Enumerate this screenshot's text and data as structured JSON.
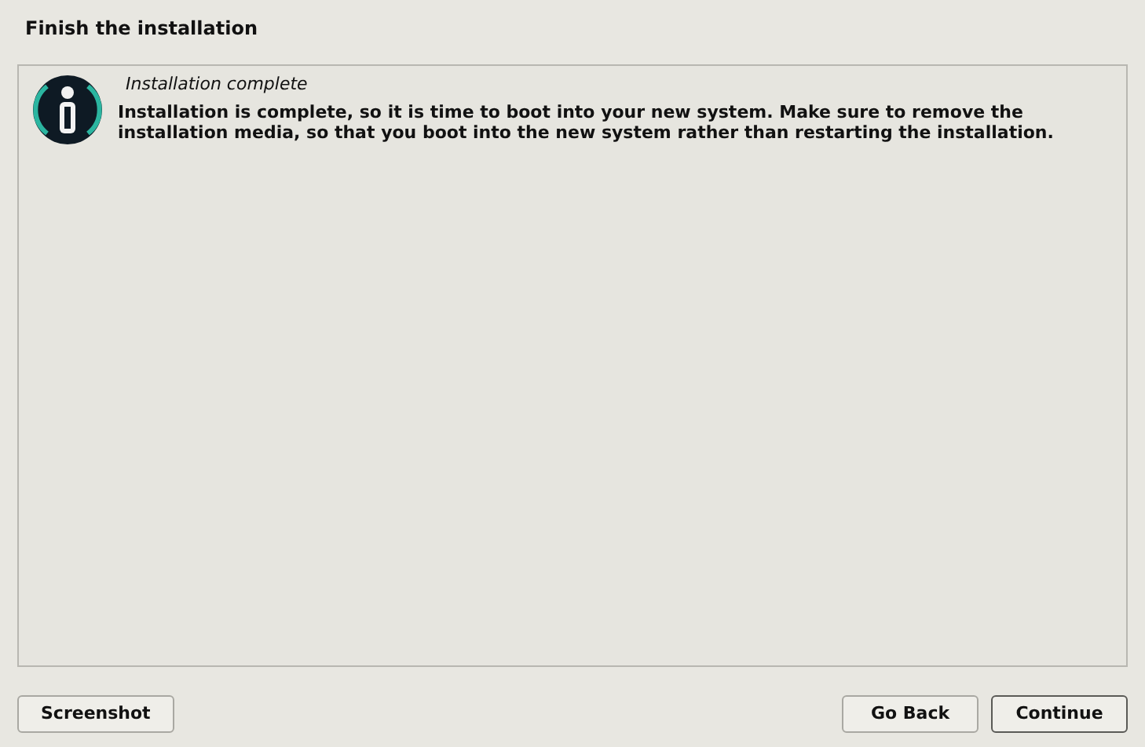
{
  "window": {
    "title": "Finish the installation"
  },
  "message": {
    "heading": "Installation complete",
    "body": "Installation is complete, so it is time to boot into your new system. Make sure to remove the installation media, so that you boot into the new system rather than restarting the installation."
  },
  "buttons_left": [
    {
      "label": "Screenshot",
      "default": false
    }
  ],
  "buttons_right": [
    {
      "label": "Go Back",
      "default": false
    },
    {
      "label": "Continue",
      "default": true
    }
  ]
}
